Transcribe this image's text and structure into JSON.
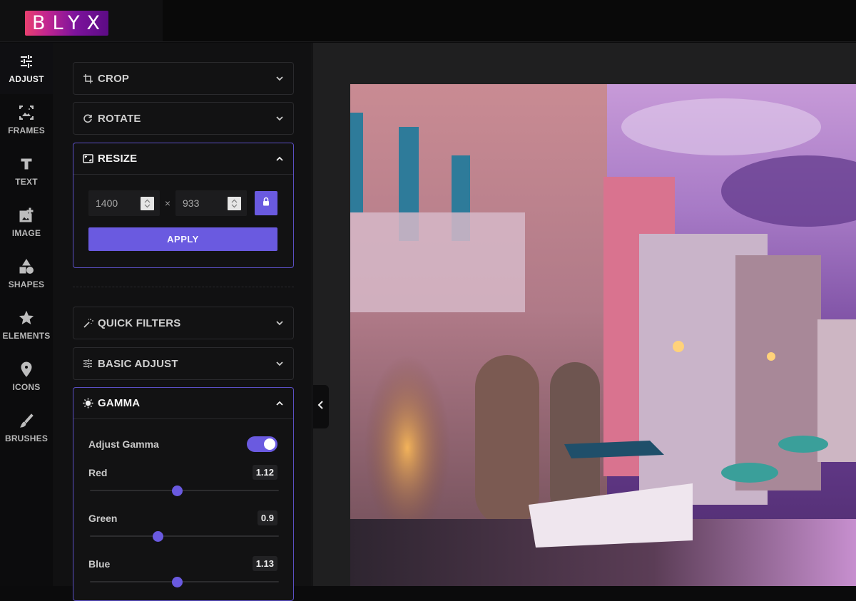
{
  "app": {
    "logo_text": "BLYX",
    "accent_color": "#6a5ae0"
  },
  "sidebar": {
    "active": "adjust",
    "items": [
      {
        "id": "adjust",
        "label": "ADJUST",
        "icon": "sliders-icon"
      },
      {
        "id": "frames",
        "label": "FRAMES",
        "icon": "frame-icon"
      },
      {
        "id": "text",
        "label": "TEXT",
        "icon": "text-icon"
      },
      {
        "id": "image",
        "label": "IMAGE",
        "icon": "add-image-icon"
      },
      {
        "id": "shapes",
        "label": "SHAPES",
        "icon": "shapes-icon"
      },
      {
        "id": "elements",
        "label": "ELEMENTS",
        "icon": "star-icon"
      },
      {
        "id": "icons",
        "label": "ICONS",
        "icon": "map-pin-icon"
      },
      {
        "id": "brushes",
        "label": "BRUSHES",
        "icon": "brush-icon"
      }
    ]
  },
  "panel": {
    "crop": {
      "title": "CROP",
      "icon": "crop-icon",
      "expanded": false
    },
    "rotate": {
      "title": "ROTATE",
      "icon": "rotate-icon",
      "expanded": false
    },
    "resize": {
      "title": "RESIZE",
      "icon": "resize-icon",
      "expanded": true,
      "width": "1400",
      "height": "933",
      "separator": "×",
      "lock_aspect": true,
      "apply_label": "APPLY"
    },
    "quick_filters": {
      "title": "QUICK FILTERS",
      "icon": "magic-wand-icon",
      "expanded": false
    },
    "basic_adjust": {
      "title": "BASIC ADJUST",
      "icon": "sliders-icon",
      "expanded": false
    },
    "gamma": {
      "title": "GAMMA",
      "icon": "sun-icon",
      "expanded": true,
      "toggle_label": "Adjust Gamma",
      "enabled": true,
      "channels": [
        {
          "label": "Red",
          "value": "1.12",
          "fraction": 0.46
        },
        {
          "label": "Green",
          "value": "0.9",
          "fraction": 0.36
        },
        {
          "label": "Blue",
          "value": "1.13",
          "fraction": 0.46
        }
      ]
    }
  }
}
